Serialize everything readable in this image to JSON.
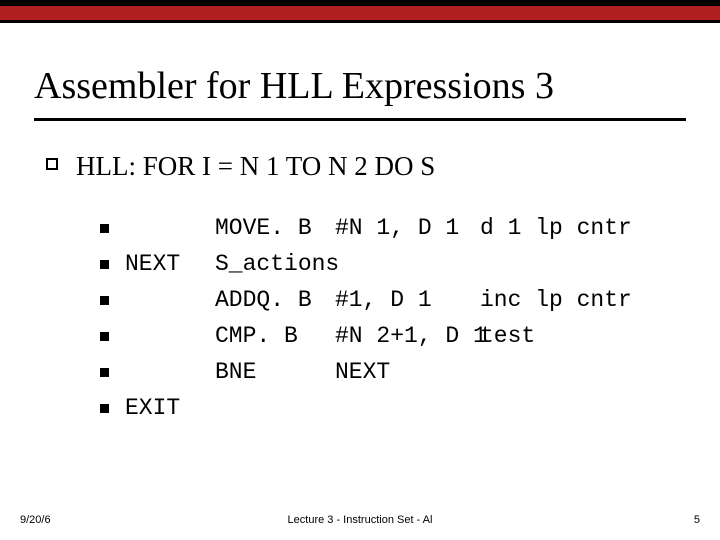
{
  "title": "Assembler for HLL Expressions 3",
  "hll_line": "HLL:  FOR I = N 1 TO N 2 DO S",
  "asm": [
    {
      "label": "",
      "mnemonic": "MOVE. B",
      "operands": "#N 1, D 1",
      "comment": "d 1 lp cntr"
    },
    {
      "label": "NEXT",
      "mnemonic": "S_actions",
      "operands": "",
      "comment": ""
    },
    {
      "label": "",
      "mnemonic": "ADDQ. B",
      "operands": "#1, D 1",
      "comment": "inc lp cntr"
    },
    {
      "label": "",
      "mnemonic": "CMP. B",
      "operands": "#N 2+1, D 1",
      "comment": "test"
    },
    {
      "label": "",
      "mnemonic": "BNE",
      "operands": "NEXT",
      "comment": ""
    },
    {
      "label": "EXIT",
      "mnemonic": "",
      "operands": "",
      "comment": ""
    }
  ],
  "footer": {
    "date": "9/20/6",
    "center": "Lecture 3 - Instruction Set - Al",
    "page": "5"
  }
}
